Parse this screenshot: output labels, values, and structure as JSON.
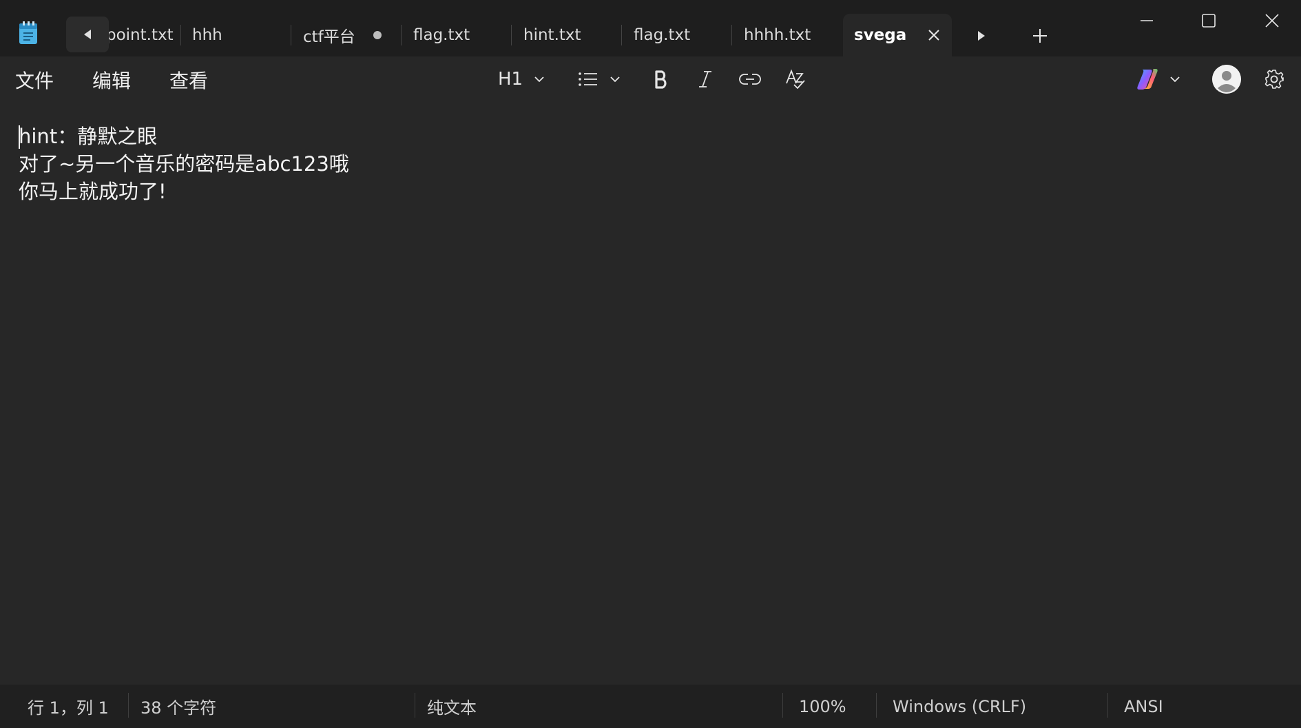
{
  "titlebar": {
    "tabs": [
      {
        "label": "point.txt",
        "modified": false,
        "active": false
      },
      {
        "label": "hhh",
        "modified": false,
        "active": false
      },
      {
        "label": "ctf平台",
        "modified": true,
        "active": false
      },
      {
        "label": "flag.txt",
        "modified": false,
        "active": false
      },
      {
        "label": "hint.txt",
        "modified": false,
        "active": false
      },
      {
        "label": "flag.txt",
        "modified": false,
        "active": false
      },
      {
        "label": "hhhh.txt",
        "modified": false,
        "active": false
      },
      {
        "label": "svega",
        "modified": false,
        "active": true
      }
    ],
    "icons": {
      "app": "notepad-icon",
      "scroll_left": "caret-left-icon",
      "scroll_right": "caret-right-icon",
      "new_tab": "plus-icon",
      "minimize": "minimize-icon",
      "maximize": "maximize-icon",
      "close": "close-icon"
    }
  },
  "menu": {
    "file": "文件",
    "edit": "编辑",
    "view": "查看"
  },
  "toolbar": {
    "heading": "H1",
    "icons": [
      "list-icon",
      "bold-icon",
      "italic-icon",
      "link-icon",
      "spellcheck-icon",
      "copilot-icon",
      "account-icon",
      "settings-icon"
    ]
  },
  "editor": {
    "lines": [
      "hint：静默之眼",
      "对了~另一个音乐的密码是abc123哦",
      "你马上就成功了!"
    ]
  },
  "status": {
    "position": "行 1，列 1",
    "chars": "38 个字符",
    "format": "纯文本",
    "zoom": "100%",
    "line_ending": "Windows (CRLF)",
    "encoding": "ANSI"
  },
  "colors": {
    "titlebar_bg": "#1e1e1e",
    "editor_bg": "#272727",
    "statusbar_bg": "#202020",
    "text": "#f2f2f2"
  }
}
